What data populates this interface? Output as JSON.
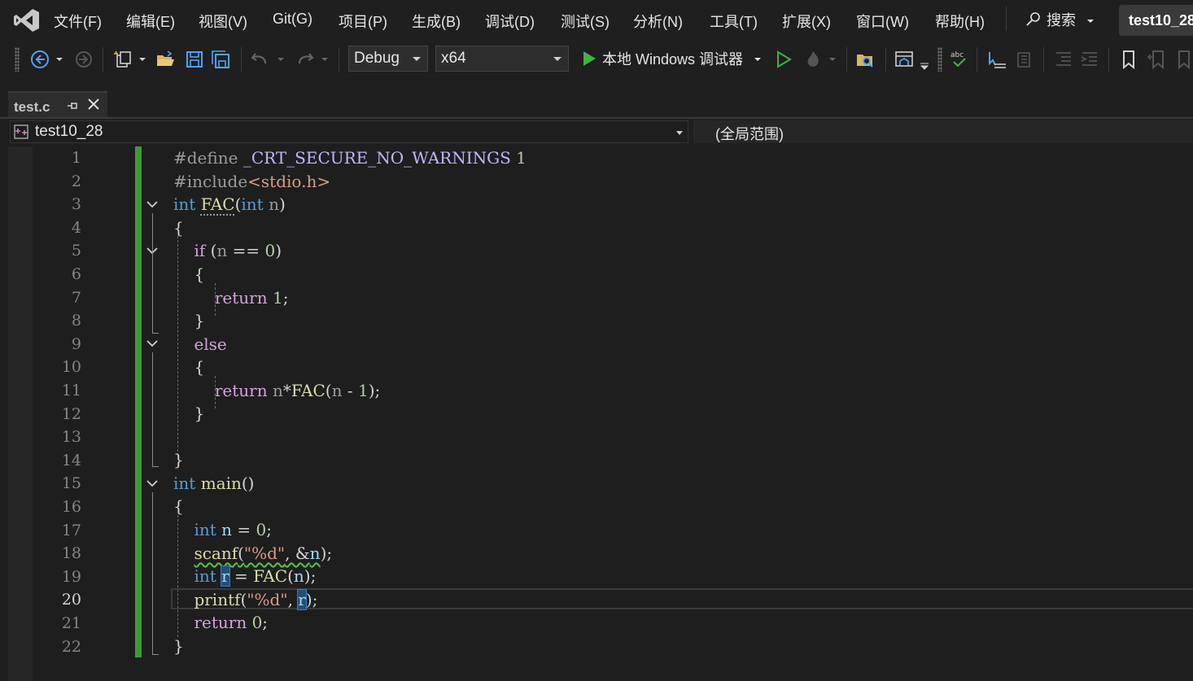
{
  "menu": {
    "items": [
      "文件(F)",
      "编辑(E)",
      "视图(V)",
      "Git(G)",
      "项目(P)",
      "生成(B)",
      "调试(D)",
      "测试(S)",
      "分析(N)",
      "工具(T)",
      "扩展(X)",
      "窗口(W)",
      "帮助(H)"
    ],
    "search_label": "搜索",
    "solution_name": "test10_28"
  },
  "toolbar": {
    "config": "Debug",
    "platform": "x64",
    "run_label": "本地 Windows 调试器"
  },
  "tab": {
    "label": "test.c"
  },
  "nav": {
    "project": "test10_28",
    "scope": "(全局范围)"
  },
  "editor": {
    "current_line": 20,
    "lines": [
      "#define _CRT_SECURE_NO_WARNINGS 1",
      "#include<stdio.h>",
      "int FAC(int n)",
      "{",
      "    if (n == 0)",
      "    {",
      "        return 1;",
      "    }",
      "    else",
      "    {",
      "        return n*FAC(n - 1);",
      "    }",
      "",
      "}",
      "int main()",
      "{",
      "    int n = 0;",
      "    scanf(\"%d\", &n);",
      "    int r = FAC(n);",
      "    printf(\"%d\", r);",
      "    return 0;",
      "}"
    ]
  },
  "colors": {
    "keyword": "#569cd6",
    "function": "#dcdcaa",
    "string": "#d69d85",
    "number": "#b5cea8",
    "macro": "#beb7ff",
    "change_bar": "#3a9c3a"
  }
}
